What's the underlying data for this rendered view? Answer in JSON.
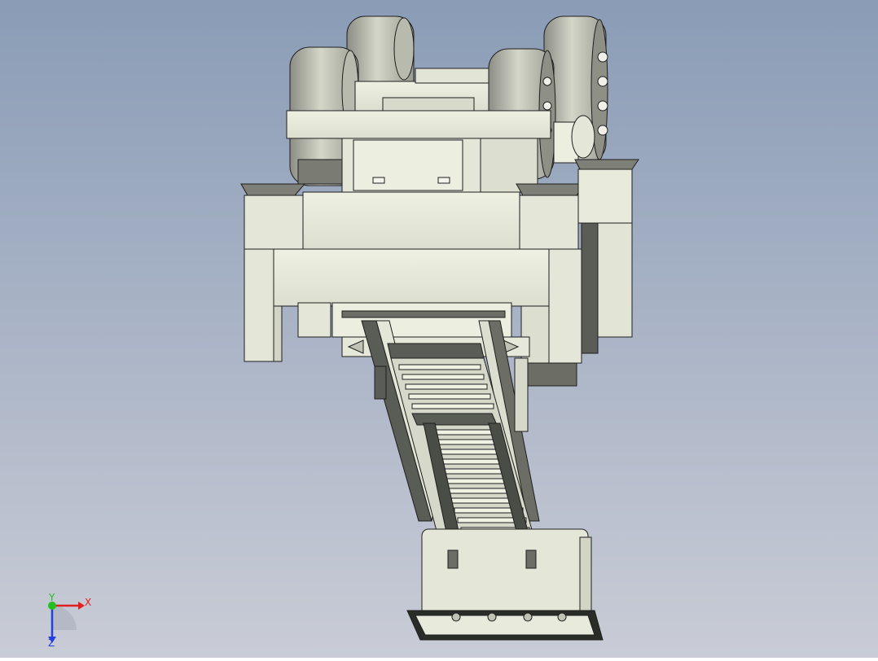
{
  "viewport": {
    "background_top": "#8a9cb6",
    "background_bottom": "#c9ccd6",
    "part_face": "#e6e8da",
    "part_shade": "#c4c6b6",
    "part_dark": "#6c6e66",
    "edge_color": "#1e1e1e"
  },
  "triad": {
    "x_label": "X",
    "y_label": "Y",
    "z_label": "Z",
    "x_color": "#e02020",
    "y_color": "#20c020",
    "z_color": "#2040e0"
  }
}
